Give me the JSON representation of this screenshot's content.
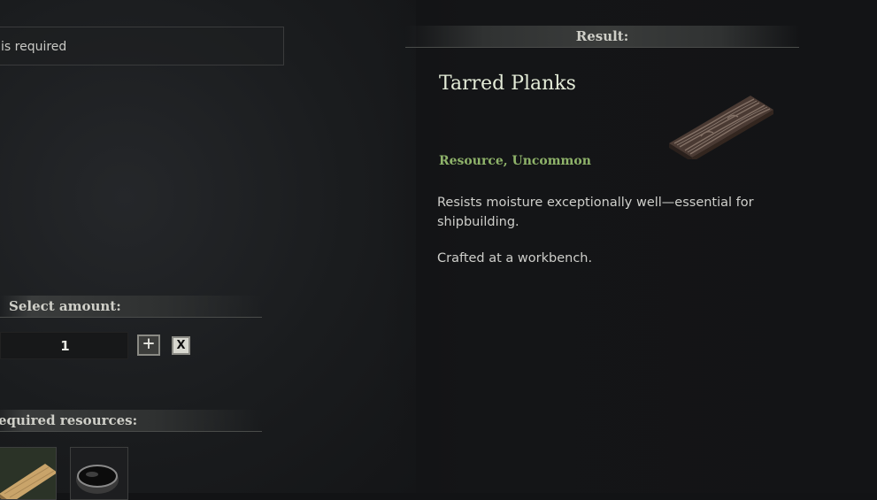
{
  "requirement": {
    "text": "is required"
  },
  "result": {
    "header": "Result:",
    "item_name": "Tarred Planks",
    "item_icon": "tarred-planks-icon",
    "item_type": "Resource, Uncommon",
    "description": "Resists moisture exceptionally well—essential for shipbuilding.",
    "crafted_at": "Crafted at a workbench.",
    "name_color": "#e4ecd8",
    "rarity_color": "#8fb36a"
  },
  "amount": {
    "header": "Select amount:",
    "value": "1",
    "increment_label": "+",
    "clear_label": "X"
  },
  "resources": {
    "header": "equired resources:",
    "items": [
      {
        "icon": "wood-plank-icon"
      },
      {
        "icon": "tar-bowl-icon"
      }
    ]
  }
}
